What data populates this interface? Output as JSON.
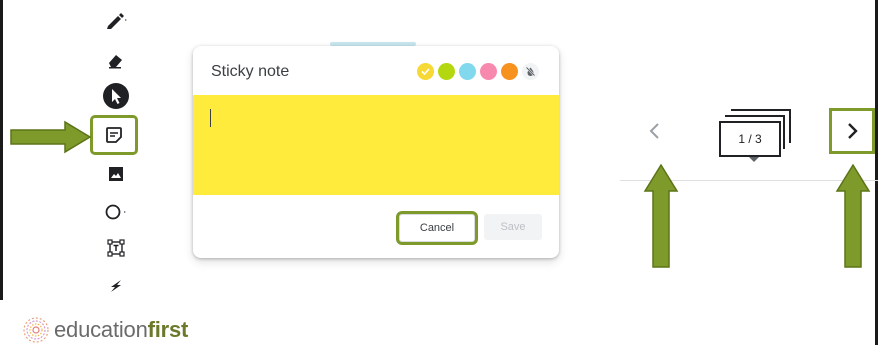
{
  "dialog": {
    "title": "Sticky note",
    "cancel_label": "Cancel",
    "save_label": "Save",
    "note_color": "#ffeb3b",
    "swatches": [
      {
        "name": "yellow",
        "color": "#f6d935",
        "selected": true
      },
      {
        "name": "green",
        "color": "#b4d80f"
      },
      {
        "name": "cyan",
        "color": "#82d8ec"
      },
      {
        "name": "pink",
        "color": "#f789ae"
      },
      {
        "name": "orange",
        "color": "#f7921e"
      }
    ]
  },
  "toolbar": {
    "tools": [
      "pen-icon",
      "eraser-icon",
      "select-icon",
      "sticky-note-icon",
      "image-icon",
      "circle-shape-icon",
      "text-box-icon",
      "laser-icon"
    ]
  },
  "navigation": {
    "counter": "1 / 3"
  },
  "logo": {
    "part1": "education",
    "part2": "first"
  },
  "colors": {
    "highlight": "#7e9a2a"
  }
}
